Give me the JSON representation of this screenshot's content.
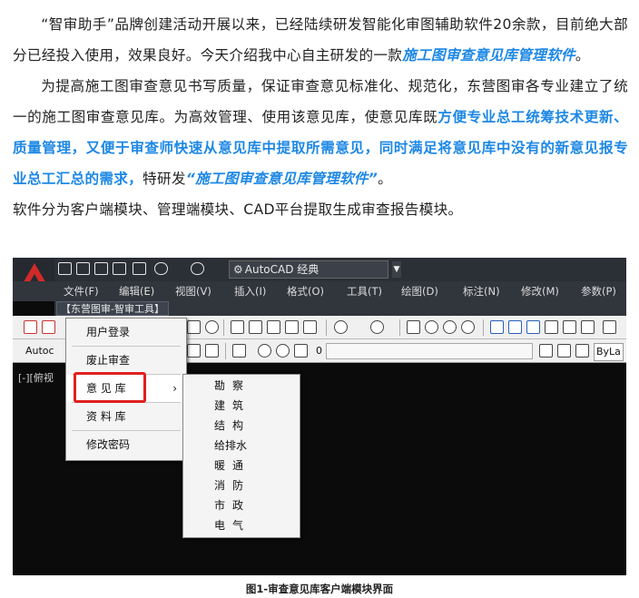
{
  "article": {
    "p1_a": "“智审助手”品牌创建活动开展以来，已经陆续研发智能化审图辅助软件20余款，目前绝大部分已经投入使用，效果良好。今天介绍我中心自主研发的一款",
    "p1_b": "施工图审查意见库管理软件",
    "p1_c": "。",
    "p2_a": "为提高施工图审查意见书写质量，保证审查意见标准化、规范化，东营图审各专业建立了统一的施工图审查意见库。为高效管理、使用该意见库，使意见库既",
    "p2_b": "方便专业总工统筹技术更新、质量管理，又便于审查师快速从意见库中提取所需意见，同时满足将意见库中没有的新意见报专业总工汇总的需求，",
    "p2_c": "特研发",
    "p2_d": "“施工图审查意见库管理软件”",
    "p2_e": "。",
    "p3": "软件分为客户端模块、管理端模块、CAD平台提取生成审查报告模块。"
  },
  "cad": {
    "workspace": "AutoCAD 经典",
    "menus": [
      "文件(F)",
      "编辑(E)",
      "视图(V)",
      "插入(I)",
      "格式(O)",
      "工具(T)",
      "绘图(D)",
      "标注(N)",
      "修改(M)",
      "参数(P)"
    ],
    "plugin_menu": "【东营图审-智审工具】",
    "toolbar2_left": "Autoc",
    "layer_value": "0",
    "bylayer": "ByLa",
    "canvas_label": "[-][俯视",
    "main_menu": [
      "用户登录",
      "废止审查",
      "意 见 库",
      "资 料 库",
      "修改密码"
    ],
    "submenu": [
      "勘察",
      "建筑",
      "结构",
      "给排水",
      "暖通",
      "消防",
      "市政",
      "电气"
    ]
  },
  "caption": "图1-审查意见库客户端模块界面",
  "colors": {
    "highlight": "#1e88e5",
    "red_box": "#e02020"
  }
}
